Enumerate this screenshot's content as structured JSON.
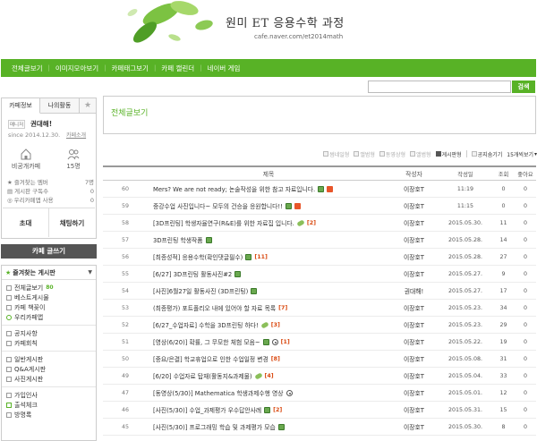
{
  "header": {
    "title": "원미 ET 응용수학 과정",
    "url": "cafe.naver.com/et2014math"
  },
  "nav": [
    "전체글보기",
    "이미지모아보기",
    "카페태그보기",
    "카페 캘린더",
    "네이버 게임"
  ],
  "search": {
    "button": "검색",
    "placeholder": ""
  },
  "sidebar": {
    "tabs": [
      "카페정보",
      "나의활동"
    ],
    "manager_badge": "매니저",
    "manager_name": "권대해!",
    "since": "since 2014.12.30.",
    "intro": "카페소개",
    "visibility": "비공개카페",
    "members": "15",
    "stats": [
      {
        "label": "즐겨찾는 멤버",
        "value": "7"
      },
      {
        "label": "게시판 구독수",
        "value": "0"
      },
      {
        "label": "우리카페앱 사용",
        "value": "0"
      }
    ],
    "invite": "초대",
    "chat": "채팅하기",
    "write": "카페 글쓰기",
    "favorites_title": "즐겨찾는 게시판",
    "board_groups": [
      [
        {
          "label": "전체글보기",
          "count": "80"
        },
        {
          "label": "베스트게시물"
        },
        {
          "label": "카페 책꽂이"
        },
        {
          "label": "우리카페앱"
        }
      ],
      [
        {
          "label": "공지사항"
        },
        {
          "label": "카페회칙"
        }
      ],
      [
        {
          "label": "일반게시판"
        },
        {
          "label": "Q&A게시판"
        },
        {
          "label": "사진게시판"
        }
      ],
      [
        {
          "label": "가입인사"
        },
        {
          "label": "출석체크"
        },
        {
          "label": "방명록"
        }
      ]
    ]
  },
  "main": {
    "title": "전체글보기",
    "view_options": [
      "썸네일형",
      "앨범형",
      "동영상형",
      "앨범형",
      "게시판형",
      "공지숨기기",
      "15개씩보기"
    ],
    "columns": {
      "title": "제목",
      "author": "작성자",
      "date": "작성일",
      "views": "조회",
      "likes": "좋아요"
    },
    "rows": [
      {
        "no": "60",
        "title": "Mers? We are not ready; 논술작성을 위한 참고 자료입니다.",
        "icons": [
          "img",
          "new"
        ],
        "comments": "",
        "author": "이장호T",
        "date": "11:19",
        "views": "0",
        "likes": "0"
      },
      {
        "no": "59",
        "title": "중강수업 사진입니다~ 모두의 건승을 응원합니다!!",
        "icons": [
          "img",
          "new"
        ],
        "comments": "",
        "author": "이장호T",
        "date": "11:15",
        "views": "0",
        "likes": "0"
      },
      {
        "no": "58",
        "title": "[3D프린팅] 학생자율연구(R&E)를 위한 자료집 입니다.",
        "icons": [
          "clip"
        ],
        "comments": "[2]",
        "author": "이장호T",
        "date": "2015.05.30.",
        "views": "11",
        "likes": "0"
      },
      {
        "no": "57",
        "title": "3D프린팅 학생작품",
        "icons": [
          "img"
        ],
        "comments": "",
        "author": "이장호T",
        "date": "2015.05.28.",
        "views": "14",
        "likes": "0"
      },
      {
        "no": "56",
        "title": "[최종성적] 응용수학(확인댓글필수)",
        "icons": [
          "img"
        ],
        "comments": "[11]",
        "author": "이장호T",
        "date": "2015.05.28.",
        "views": "27",
        "likes": "0"
      },
      {
        "no": "55",
        "title": "[6/27] 3D프린팅 활동사진#2",
        "icons": [
          "img"
        ],
        "comments": "",
        "author": "이장호T",
        "date": "2015.05.27.",
        "views": "9",
        "likes": "0"
      },
      {
        "no": "54",
        "title": "[사진]6월27일 활동사진 (3D프린팅)",
        "icons": [
          "img"
        ],
        "comments": "",
        "author": "권대해!",
        "date": "2015.05.27.",
        "views": "17",
        "likes": "0"
      },
      {
        "no": "53",
        "title": "(최종평가) 포트폴리오 내에 있어야 할 자료 목록",
        "icons": [],
        "comments": "[7]",
        "author": "이장호T",
        "date": "2015.05.23.",
        "views": "34",
        "likes": "0"
      },
      {
        "no": "52",
        "title": "[6/27_수업자료] 수학을 3D프린팅 하다!",
        "icons": [
          "clip"
        ],
        "comments": "[3]",
        "author": "이장호T",
        "date": "2015.05.23.",
        "views": "29",
        "likes": "0"
      },
      {
        "no": "51",
        "title": "[영상(6/20)] 확률, 그 무모한 체험 모음~",
        "icons": [
          "img",
          "video"
        ],
        "comments": "[1]",
        "author": "이장호T",
        "date": "2015.05.22.",
        "views": "19",
        "likes": "0"
      },
      {
        "no": "50",
        "title": "[중요/은결] 학교휴업으로 인한 수업일정 변경",
        "icons": [],
        "comments": "[8]",
        "author": "이장호T",
        "date": "2015.05.08.",
        "views": "31",
        "likes": "0"
      },
      {
        "no": "49",
        "title": "[6/20] 수업자료 탑재(활동지&과제물)",
        "icons": [
          "clip"
        ],
        "comments": "[4]",
        "author": "이장호T",
        "date": "2015.05.04.",
        "views": "33",
        "likes": "0"
      },
      {
        "no": "47",
        "title": "[동영상(5/30)] Mathematica 학생과제수행 영상",
        "icons": [
          "video"
        ],
        "comments": "",
        "author": "이장호T",
        "date": "2015.05.01.",
        "views": "12",
        "likes": "0"
      },
      {
        "no": "46",
        "title": "[사진(5/30)] 수업_과제평가 우수답안사례",
        "icons": [
          "img"
        ],
        "comments": "[2]",
        "author": "이장호T",
        "date": "2015.05.31.",
        "views": "15",
        "likes": "0"
      },
      {
        "no": "45",
        "title": "[사진(5/30)] 프로그래밍 학습 및 과제평가 모습",
        "icons": [
          "img"
        ],
        "comments": "",
        "author": "이장호T",
        "date": "2015.05.30.",
        "views": "8",
        "likes": "0"
      }
    ]
  },
  "colors": {
    "accent": "#58b226",
    "comment": "#d9480f"
  }
}
